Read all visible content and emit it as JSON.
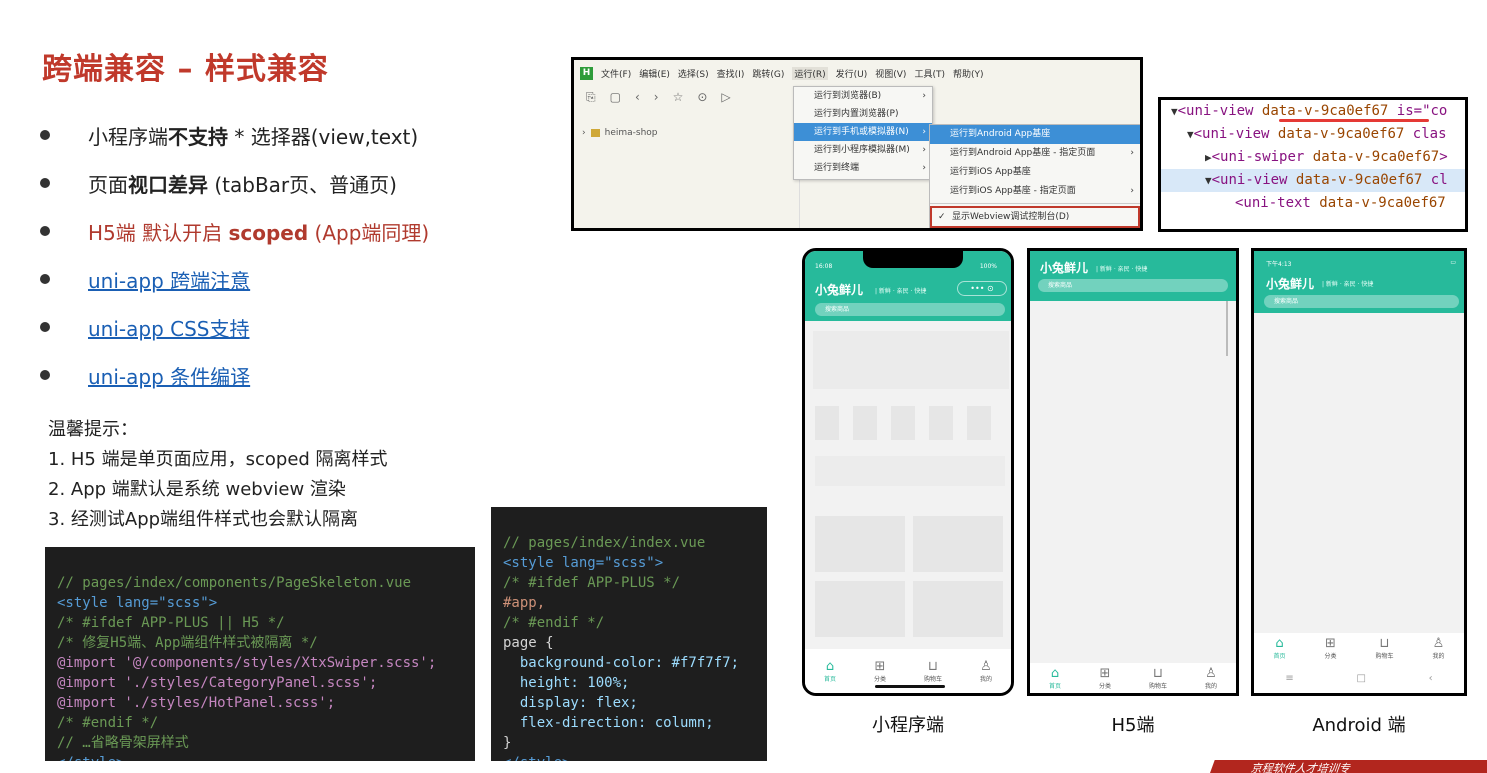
{
  "title": "跨端兼容 – 样式兼容",
  "bullets": [
    {
      "pre": "小程序端",
      "bold": "不支持",
      "post": " * 选择器(view,text)"
    },
    {
      "pre": "页面",
      "bold": "视口差异",
      "post": " (tabBar页、普通页)"
    },
    {
      "pre": "H5端 默认开启 ",
      "bold": "scoped",
      "post": " (App端同理)"
    },
    {
      "link": "uni-app 跨端注意"
    },
    {
      "link": "uni-app CSS支持"
    },
    {
      "link": "uni-app 条件编译"
    }
  ],
  "tips": {
    "heading": "温馨提示：",
    "items": [
      "1.  H5 端是单页面应用，scoped 隔离样式",
      "2.  App 端默认是系统 webview 渲染",
      "3.  经测试App端组件样式也会默认隔离"
    ]
  },
  "code1": [
    "// pages/index/components/PageSkeleton.vue",
    "<style lang=\"scss\">",
    "/* #ifdef APP-PLUS || H5 */",
    "/* 修复H5端、App端组件样式被隔离 */",
    "@import '@/components/styles/XtxSwiper.scss';",
    "@import './styles/CategoryPanel.scss';",
    "@import './styles/HotPanel.scss';",
    "/* #endif */",
    "// …省略骨架屏样式",
    "</style>"
  ],
  "code2": [
    "// pages/index/index.vue",
    "<style lang=\"scss\">",
    "/* #ifdef APP-PLUS */",
    "#app,",
    "/* #endif */",
    "page {",
    "  background-color: #f7f7f7;",
    "  height: 100%;",
    "  display: flex;",
    "  flex-direction: column;",
    "}",
    "</style>"
  ],
  "ide": {
    "logo": "H",
    "menus": [
      "文件(F)",
      "编辑(E)",
      "选择(S)",
      "查找(I)",
      "跳转(G)",
      "运行(R)",
      "发行(U)",
      "视图(V)",
      "工具(T)",
      "帮助(Y)"
    ],
    "project": "heima-shop",
    "run_menu": [
      "运行到浏览器(B)",
      "运行到内置浏览器(P)",
      "运行到手机或模拟器(N)",
      "运行到小程序模拟器(M)",
      "运行到终端"
    ],
    "device_menu": [
      "运行到Android App基座",
      "运行到Android App基座 - 指定页面",
      "运行到iOS App基座",
      "运行到iOS App基座 - 指定页面"
    ],
    "webview_item": "显示Webview调试控制台(D)"
  },
  "devtools": [
    {
      "tag": "<uni-view",
      "attr": "data-v-9ca0ef67",
      "rest": " is=\"co"
    },
    {
      "tag": "<uni-view",
      "attr": "data-v-9ca0ef67",
      "rest": " clas"
    },
    {
      "tag": "<uni-swiper",
      "attr": "data-v-9ca0ef67",
      "rest": ">"
    },
    {
      "tag": "<uni-view",
      "attr": "data-v-9ca0ef67",
      "rest": " cl"
    },
    {
      "tag": "<uni-text",
      "attr": "data-v-9ca0ef67",
      "rest": ""
    }
  ],
  "phone": {
    "brand": "小兔鲜儿",
    "slogan": "| 新鲜 · 亲民 · 快捷",
    "search": "搜索商品",
    "tabs": [
      "首页",
      "分类",
      "购物车",
      "我的"
    ],
    "status_mp_time": "16:08",
    "status_mp_batt": "100%",
    "status_android_time": "下午4:13"
  },
  "captions": [
    "小程序端",
    "H5端",
    "Android 端"
  ],
  "footer": "京程软件人才培训专"
}
